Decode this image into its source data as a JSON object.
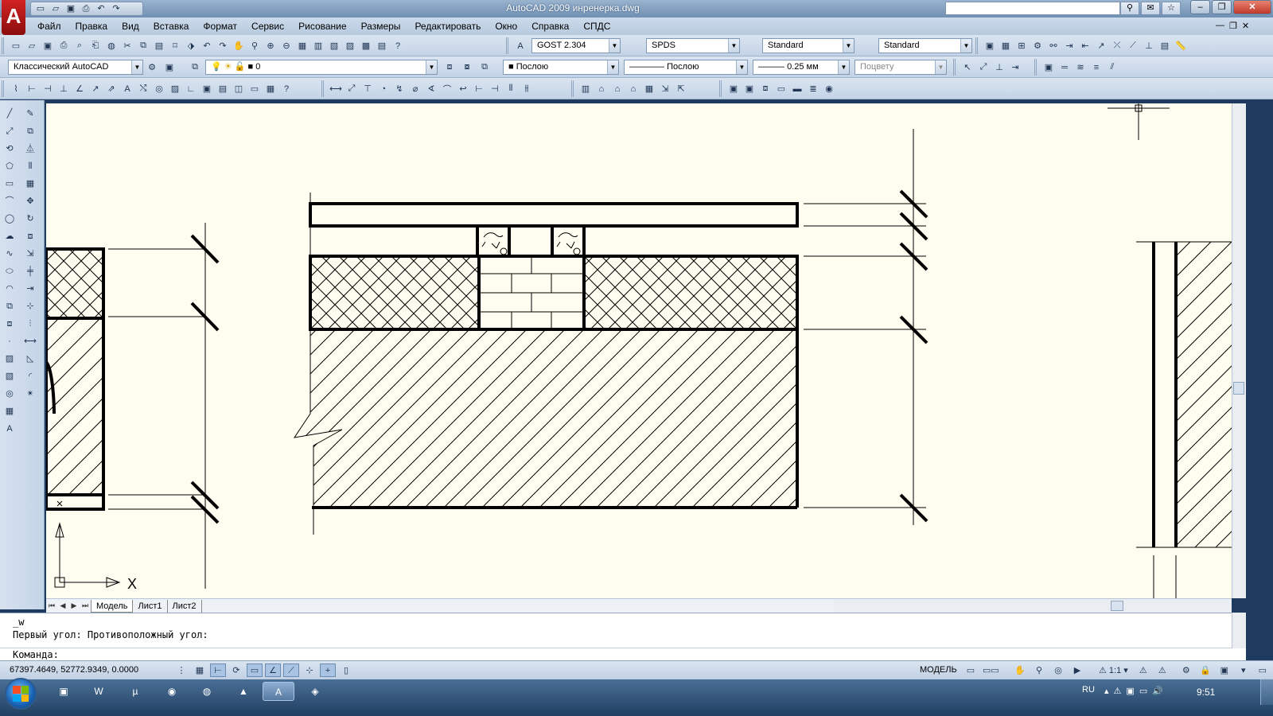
{
  "title": "AutoCAD 2009 инренерка.dwg",
  "app_logo": "A",
  "quick_access": [
    "new",
    "open",
    "save",
    "plot",
    "undo",
    "redo"
  ],
  "menu": [
    "Файл",
    "Правка",
    "Вид",
    "Вставка",
    "Формат",
    "Сервис",
    "Рисование",
    "Размеры",
    "Редактировать",
    "Окно",
    "Справка",
    "СПДС"
  ],
  "styles": {
    "text_style": "GOST 2.304",
    "dim_style": "SPDS",
    "table_style": "Standard",
    "multileader_style": "Standard"
  },
  "workspace": "Классический AutoCAD",
  "layer": "0",
  "properties": {
    "color": "Послою",
    "linetype": "Послою",
    "lineweight": "0.25 мм",
    "plot_style": "Поцвету"
  },
  "sheet_tabs": [
    "Модель",
    "Лист1",
    "Лист2"
  ],
  "active_tab": "Модель",
  "command": {
    "history": [
      "_w",
      "Первый угол: Противоположный угол:"
    ],
    "prompt": "Команда:"
  },
  "status": {
    "coordinates": "67397.4649, 52772.9349, 0.0000",
    "space": "МОДЕЛЬ",
    "annotation_scale": "1:1"
  },
  "ucs": {
    "x_label": "X"
  },
  "taskbar": {
    "language": "RU",
    "time": "9:51"
  },
  "icons": {
    "draw_tools": [
      "line-icon",
      "xline-icon",
      "polyline-icon",
      "polygon-icon",
      "rectangle-icon",
      "arc-icon",
      "circle-icon",
      "revcloud-icon",
      "spline-icon",
      "ellipse-icon",
      "ellipse-arc-icon",
      "insert-block-icon",
      "make-block-icon",
      "point-icon",
      "hatch-icon",
      "gradient-icon",
      "region-icon",
      "table-icon",
      "mtext-icon"
    ],
    "modify_tools": [
      "erase-icon",
      "copy-icon",
      "mirror-icon",
      "offset-icon",
      "array-icon",
      "move-icon",
      "rotate-icon",
      "scale-icon",
      "stretch-icon",
      "trim-icon",
      "extend-icon",
      "break-at-point-icon",
      "break-icon",
      "join-icon",
      "chamfer-icon",
      "fillet-icon",
      "explode-icon"
    ]
  },
  "colors": {
    "canvas_bg": "#fffdf0",
    "titlebar": "#7f9dbf",
    "taskbar": "#2e4f75",
    "logo": "#c41e1e"
  }
}
